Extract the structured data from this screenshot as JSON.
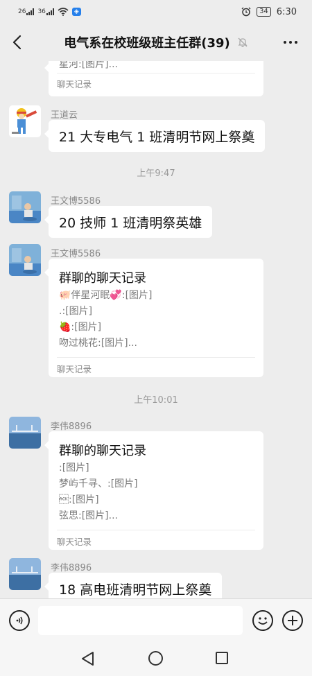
{
  "status_bar": {
    "signal1": "26",
    "signal2": "36",
    "battery": "34",
    "time": "6:30"
  },
  "header": {
    "title": "电气系在校班级班主任群(39)",
    "icons": [
      "back-arrow-icon",
      "mute-bell-icon",
      "more-dots-icon"
    ]
  },
  "messages": [
    {
      "type": "card-partial",
      "last_line": "星河:[图片]...",
      "footer": "聊天记录"
    },
    {
      "type": "text",
      "sender": "王道云",
      "text": "21 大专电气 1 班清明节网上祭奠"
    },
    {
      "type": "time",
      "text": "上午9:47"
    },
    {
      "type": "text",
      "sender": "王文博5586",
      "text": "20 技师 1 班清明祭英雄"
    },
    {
      "type": "card",
      "sender": "王文博5586",
      "title": "群聊的聊天记录",
      "lines": [
        "🐖伴星河眠💞:[图片]",
        ".:[图片]",
        "🍓:[图片]",
        "吻过桃花:[图片]..."
      ],
      "footer": "聊天记录"
    },
    {
      "type": "time",
      "text": "上午10:01"
    },
    {
      "type": "card",
      "sender": "李伟8896",
      "title": "群聊的聊天记录",
      "lines": [
        ":[图片]",
        "梦屿千寻、:[图片]",
        "\u0006:[图片]",
        "弦思:[图片]..."
      ],
      "footer": "聊天记录"
    },
    {
      "type": "text",
      "sender": "李伟8896",
      "text": "18 高电班清明节网上祭奠"
    }
  ],
  "input_bar": {
    "placeholder": "",
    "icons": [
      "voice-icon",
      "emoji-icon",
      "plus-icon"
    ]
  },
  "nav_bar": {
    "icons": [
      "nav-back-icon",
      "nav-home-icon",
      "nav-recent-icon"
    ]
  }
}
